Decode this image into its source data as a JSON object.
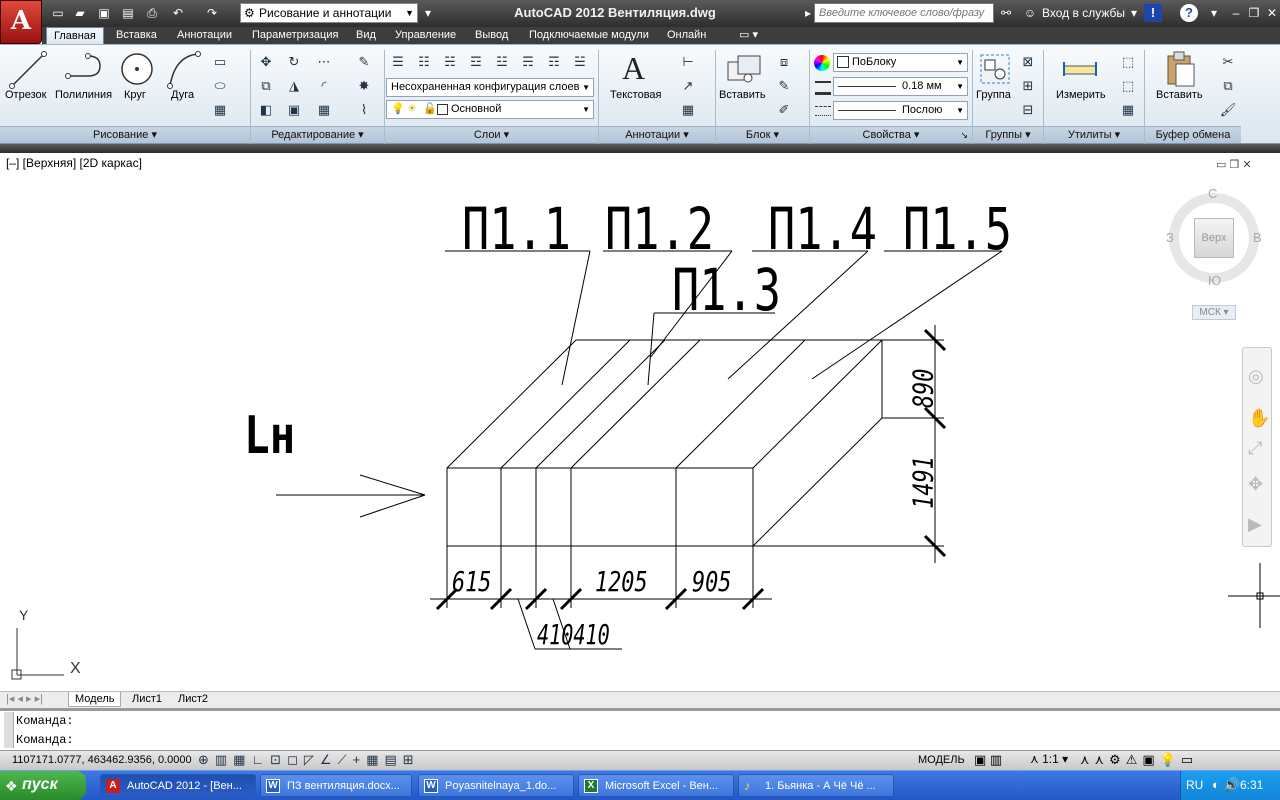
{
  "app": {
    "title": "AutoCAD 2012   Вентиляция.dwg",
    "logo": "A",
    "workspace": "Рисование и аннотации",
    "search_placeholder": "Введите ключевое слово/фразу",
    "sign_in": "Вход в службы"
  },
  "ribbon_tabs": [
    "Главная",
    "Вставка",
    "Аннотации",
    "Параметризация",
    "Вид",
    "Управление",
    "Вывод",
    "Подключаемые модули",
    "Онлайн"
  ],
  "draw_panel": {
    "title": "Рисование",
    "buttons": [
      "Отрезок",
      "Полилиния",
      "Круг",
      "Дуга"
    ]
  },
  "modify_panel": {
    "title": "Редактирование"
  },
  "layers_panel": {
    "title": "Слои",
    "layer_state": "Несохраненная конфигурация слоев",
    "current_layer": "Основной"
  },
  "annotation_panel": {
    "title": "Аннотации",
    "text_button": "Текстовая"
  },
  "block_panel": {
    "title": "Блок",
    "insert_button": "Вставить"
  },
  "properties_panel": {
    "title": "Свойства",
    "color": "ПоБлоку",
    "lineweight": "0.18 мм",
    "linetype": "Послою"
  },
  "groups_panel": {
    "title": "Группы",
    "group_button": "Группа"
  },
  "utilities_panel": {
    "title": "Утилиты",
    "measure_button": "Измерить"
  },
  "clipboard_panel": {
    "title": "Буфер обмена",
    "paste_button": "Вставить"
  },
  "viewport": {
    "label": "[–] [Верхняя] [2D каркас]",
    "viewcube": {
      "north": "С",
      "south": "Ю",
      "west": "З",
      "east": "В",
      "face": "Верх",
      "ucs": "МСК"
    },
    "ucs_y": "Y",
    "ucs_x": "X"
  },
  "drawing": {
    "labels": [
      "П1.1",
      "П1.2",
      "П1.3",
      "П1.4",
      "П1.5"
    ],
    "flow_label": "Lн",
    "dims_bottom": [
      "615",
      "1205",
      "905"
    ],
    "dims_small": "410410",
    "dims_right": [
      "890",
      "1491"
    ]
  },
  "layout_tabs": [
    "Модель",
    "Лист1",
    "Лист2"
  ],
  "command_lines": [
    "Команда:",
    "Команда:"
  ],
  "status": {
    "coords": "1107171.0777, 463462.9356, 0.0000",
    "mode": "МОДЕЛЬ",
    "scale": "1:1"
  },
  "taskbar": {
    "start": "пуск",
    "items": [
      "AutoCAD 2012 - [Вен...",
      "ПЗ вентиляция.docx...",
      "Poyasnitelnaya_1.do...",
      "Microsoft Excel - Вен...",
      "1. Бьянка - А Чё Чё ..."
    ],
    "lang": "RU",
    "time": "6:31"
  },
  "colors": {
    "accent": "#c01818",
    "ribbon_bg": "#dbe6ef",
    "taskbar": "#2357c8",
    "start": "#2b8a2b"
  }
}
